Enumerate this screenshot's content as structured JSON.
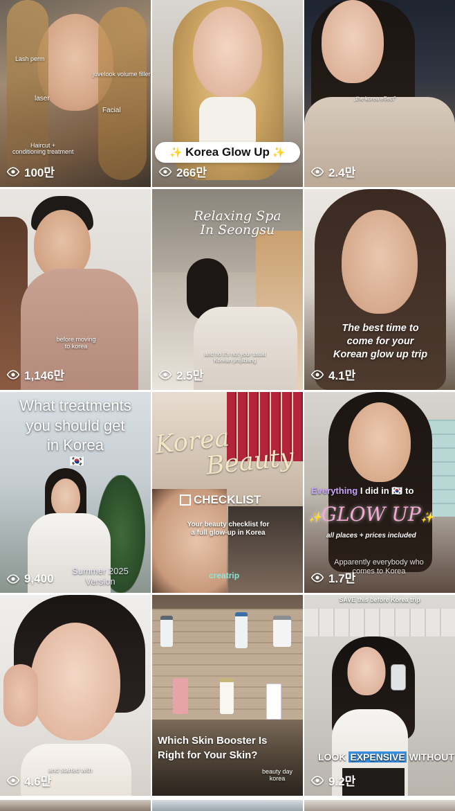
{
  "tiles": [
    {
      "views": "100만",
      "captions": [
        "Lash perm",
        "juvelook volume filler",
        "laser",
        "Facial",
        "Haircut +",
        "conditioning treatment"
      ]
    },
    {
      "views": "266만",
      "title": "Korea Glow Up"
    },
    {
      "views": "2.4만",
      "caption": "„the korea effect\""
    },
    {
      "views": "1,146만",
      "caption_line1": "before moving",
      "caption_line2": "to korea"
    },
    {
      "views": "2.5만",
      "title_line1": "Relaxing Spa",
      "title_line2": "In Seongsu",
      "caption_line1": "and no it's not your usual",
      "caption_line2": "Korean jimjilbang"
    },
    {
      "views": "4.1만",
      "title_line1": "The best time to",
      "title_line2": "come for your",
      "title_line3": "Korean glow up trip"
    },
    {
      "views": "9,400",
      "title_line1": "What treatments",
      "title_line2": "you should get",
      "title_line3": "in Korea",
      "flag": "🇰🇷",
      "footer_line1": "Summer 2025",
      "footer_line2": "Version"
    },
    {
      "views": "",
      "script_line1": "Korea",
      "script_line2": "Beauty",
      "checklist": "CHECKLIST",
      "sub_line1": "Your beauty checklist for",
      "sub_line2": "a full glow-up in Korea",
      "brand": "creatrip"
    },
    {
      "views": "1.7만",
      "line1_a": "Everything",
      "line1_b": "I did in",
      "line1_flag": "🇰🇷",
      "line1_c": "to",
      "glow": "GLOW UP",
      "sub": "all places + prices included",
      "caption_line1": "Apparently everybody who",
      "caption_line2": "comes to Korea"
    },
    {
      "views": "4.6만",
      "caption": "and started with"
    },
    {
      "views": "",
      "title_line1": "Which Skin Booster Is",
      "title_line2": "Right for Your Skin?",
      "brand_line1": "beauty day",
      "brand_line2": "korea"
    },
    {
      "views": "9.2만",
      "top": "SAVE this before Korea trip",
      "banner_a": "LOOK",
      "banner_b": "EXPENSIVE",
      "banner_c": "WITHOUT"
    }
  ],
  "icons": {
    "views": "eye-icon"
  },
  "colors": {
    "overlay_text": "#ffffff",
    "glow_pink": "#f5a9d6",
    "purple": "#c9a5ff",
    "banner_blue": "#3a8dde"
  }
}
